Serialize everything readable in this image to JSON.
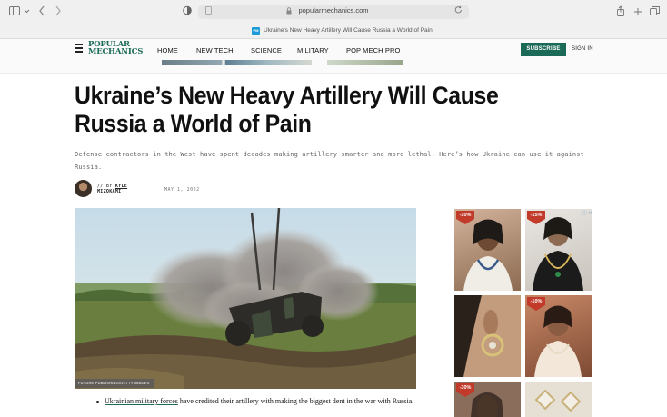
{
  "browser": {
    "url": "popularmechanics.com",
    "tab_title": "Ukraine's New Heavy Artillery Will Cause Russia a World of Pain"
  },
  "nav": {
    "logo_line1": "POPULAR",
    "logo_line2": "MECHANICS",
    "links": [
      "HOME",
      "NEW TECH",
      "SCIENCE",
      "MILITARY",
      "POP MECH PRO"
    ],
    "subscribe": "SUBSCRIBE",
    "sign_in": "SIGN IN",
    "brand_color": "#1b6a57"
  },
  "article": {
    "headline": "Ukraine’s New Heavy Artillery Will Cause Russia a World of Pain",
    "dek": "Defense contractors in the West have spent decades making artillery smarter and more lethal. Here’s how Ukraine can use it against Russia.",
    "byline_prefix": "// BY",
    "author_first": "KYLE",
    "author_last": "MIZOKAMI",
    "date": "MAY 1, 2022",
    "image_credit": "FUTURE PUBLISHING/GETTY IMAGES",
    "bullet_link": "Ukrainian military forces",
    "bullet_rest": " have credited their artillery with making the biggest dent in the war with Russia."
  },
  "ad": {
    "adchoices": "ⓘ ✕",
    "tiles": [
      {
        "badge": "-10%",
        "subject": "necklace-model"
      },
      {
        "badge": "-15%",
        "subject": "necklace-model"
      },
      {
        "badge": "",
        "subject": "earring-closeup"
      },
      {
        "badge": "-10%",
        "subject": "necklace-model"
      },
      {
        "badge": "-30%",
        "subject": "earring-model"
      },
      {
        "badge": "",
        "subject": "earring-closeup"
      }
    ]
  },
  "icons": {
    "sidebar": "sidebar-icon",
    "back": "chevron-left-icon",
    "forward": "chevron-right-icon",
    "privacy": "shield-icon",
    "share": "share-icon",
    "new_tab": "plus-icon",
    "tabs": "tabs-icon",
    "reload": "reload-icon",
    "lock": "lock-icon"
  }
}
